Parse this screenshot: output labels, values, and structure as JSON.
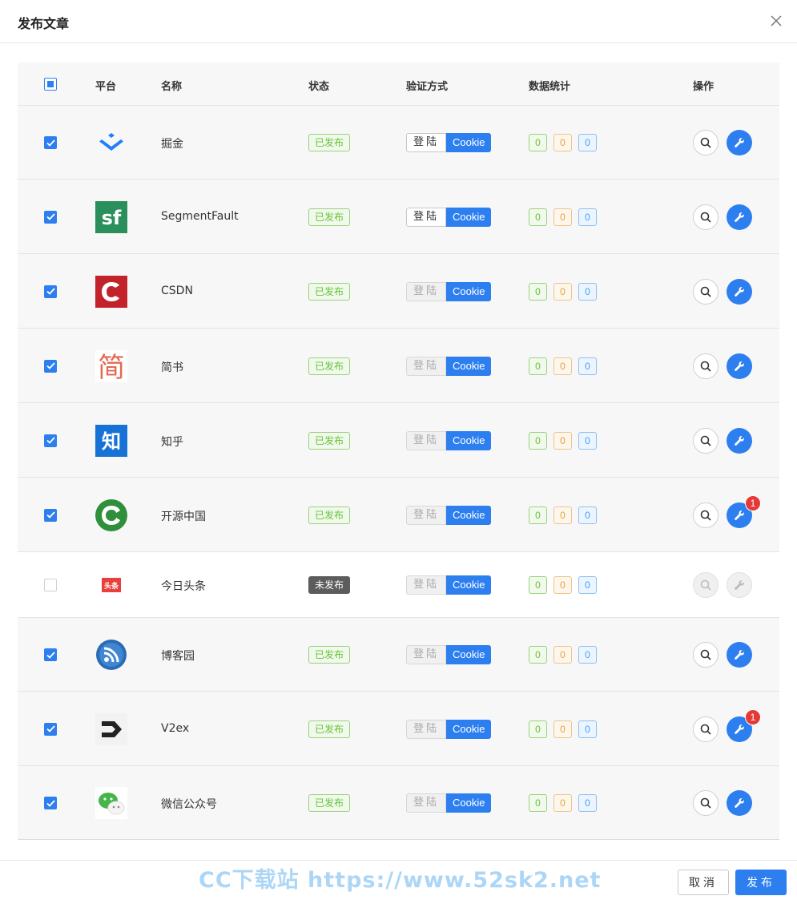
{
  "dialog": {
    "title": "发布文章"
  },
  "table": {
    "headers": {
      "platform": "平台",
      "name": "名称",
      "status": "状态",
      "auth": "验证方式",
      "stats": "数据统计",
      "ops": "操作"
    },
    "rows": [
      {
        "name": "掘金",
        "logo": "juejin-logo",
        "checked": true,
        "status": "已发布",
        "published": true,
        "login_label": "登陆",
        "login_enabled": true,
        "cookie_label": "Cookie",
        "stats": [
          "0",
          "0",
          "0"
        ],
        "badge": ""
      },
      {
        "name": "SegmentFault",
        "logo": "segmentfault-logo",
        "logo_text": "sf",
        "checked": true,
        "status": "已发布",
        "published": true,
        "login_label": "登陆",
        "login_enabled": true,
        "cookie_label": "Cookie",
        "stats": [
          "0",
          "0",
          "0"
        ],
        "badge": ""
      },
      {
        "name": "CSDN",
        "logo": "csdn-logo",
        "checked": true,
        "status": "已发布",
        "published": true,
        "login_label": "登陆",
        "login_enabled": false,
        "cookie_label": "Cookie",
        "stats": [
          "0",
          "0",
          "0"
        ],
        "badge": ""
      },
      {
        "name": "简书",
        "logo": "jianshu-logo",
        "logo_text": "简",
        "checked": true,
        "status": "已发布",
        "published": true,
        "login_label": "登陆",
        "login_enabled": false,
        "cookie_label": "Cookie",
        "stats": [
          "0",
          "0",
          "0"
        ],
        "badge": ""
      },
      {
        "name": "知乎",
        "logo": "zhihu-logo",
        "logo_text": "知",
        "checked": true,
        "status": "已发布",
        "published": true,
        "login_label": "登陆",
        "login_enabled": false,
        "cookie_label": "Cookie",
        "stats": [
          "0",
          "0",
          "0"
        ],
        "badge": ""
      },
      {
        "name": "开源中国",
        "logo": "oschina-logo",
        "checked": true,
        "status": "已发布",
        "published": true,
        "login_label": "登陆",
        "login_enabled": false,
        "cookie_label": "Cookie",
        "stats": [
          "0",
          "0",
          "0"
        ],
        "badge": "1"
      },
      {
        "name": "今日头条",
        "logo": "toutiao-logo",
        "logo_text": "头条",
        "checked": false,
        "status": "未发布",
        "published": false,
        "login_label": "登陆",
        "login_enabled": false,
        "cookie_label": "Cookie",
        "stats": [
          "0",
          "0",
          "0"
        ],
        "badge": ""
      },
      {
        "name": "博客园",
        "logo": "cnblogs-logo",
        "checked": true,
        "status": "已发布",
        "published": true,
        "login_label": "登陆",
        "login_enabled": false,
        "cookie_label": "Cookie",
        "stats": [
          "0",
          "0",
          "0"
        ],
        "badge": ""
      },
      {
        "name": "V2ex",
        "logo": "v2ex-logo",
        "checked": true,
        "status": "已发布",
        "published": true,
        "login_label": "登陆",
        "login_enabled": false,
        "cookie_label": "Cookie",
        "stats": [
          "0",
          "0",
          "0"
        ],
        "badge": "1"
      },
      {
        "name": "微信公众号",
        "logo": "wechat-logo",
        "checked": true,
        "status": "已发布",
        "published": true,
        "login_label": "登陆",
        "login_enabled": false,
        "cookie_label": "Cookie",
        "stats": [
          "0",
          "0",
          "0"
        ],
        "badge": ""
      }
    ]
  },
  "footer": {
    "cancel_label": "取消",
    "publish_label": "发布",
    "watermark": "CC下载站 https://www.52sk2.net"
  },
  "colors": {
    "primary": "#2d7ff0",
    "success": "#67c23a",
    "warning": "#e6a23c",
    "info": "#409eff",
    "badge": "#e53935"
  }
}
